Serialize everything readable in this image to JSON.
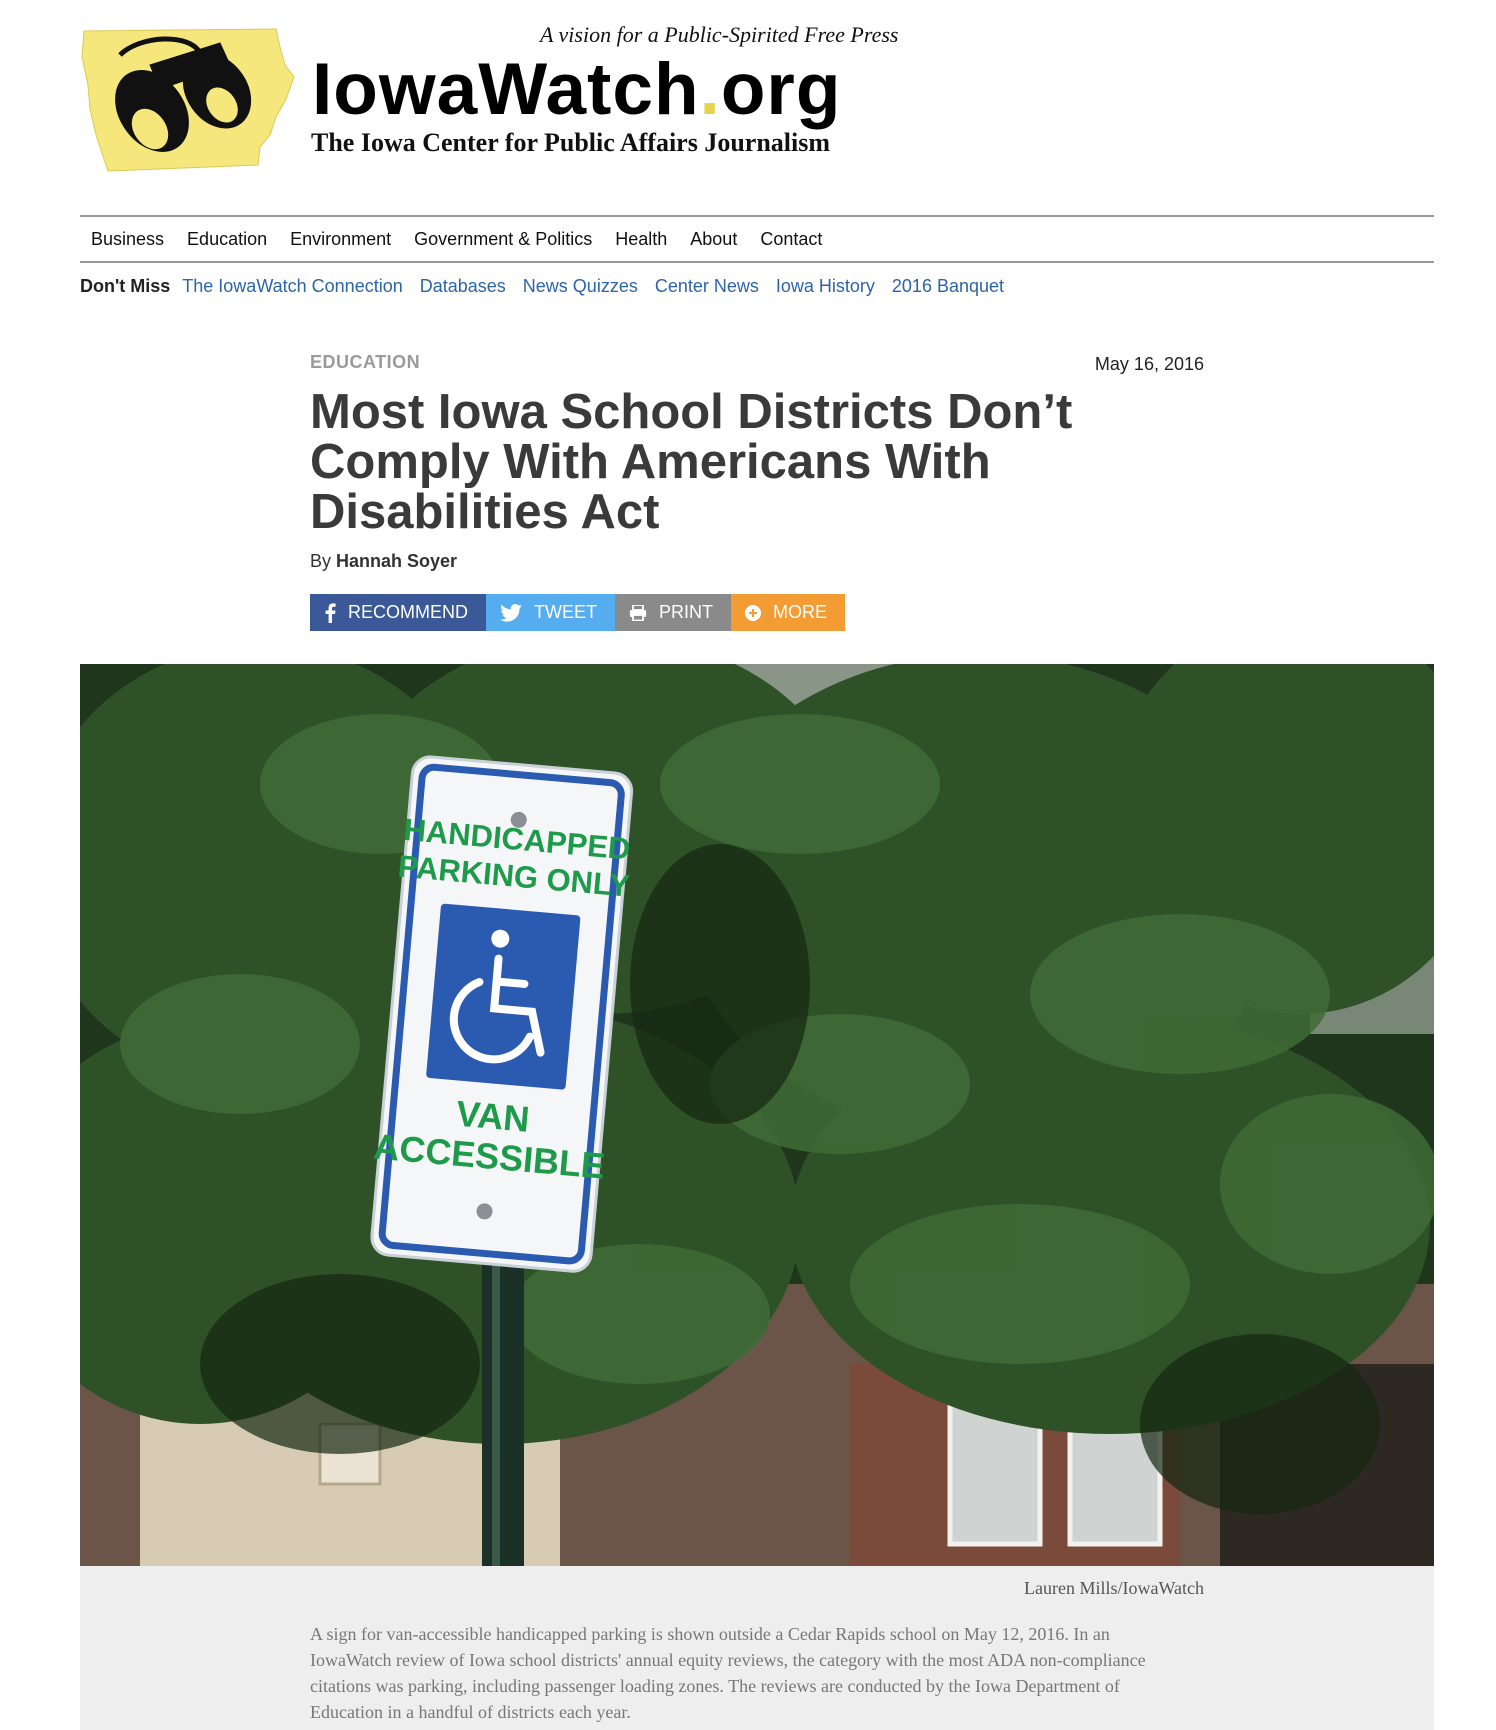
{
  "site": {
    "tagline": "A vision for a Public-Spirited Free Press",
    "logo_main": "IowaWatch",
    "logo_dot": ".",
    "logo_tld": "org",
    "logo_sub": "The Iowa Center for Public Affairs Journalism"
  },
  "nav": {
    "items": [
      "Business",
      "Education",
      "Environment",
      "Government & Politics",
      "Health",
      "About",
      "Contact"
    ]
  },
  "dont_miss": {
    "label": "Don't Miss",
    "links": [
      "The IowaWatch Connection",
      "Databases",
      "News Quizzes",
      "Center News",
      "Iowa History",
      "2016 Banquet"
    ]
  },
  "article": {
    "category": "EDUCATION",
    "date": "May 16, 2016",
    "headline": "Most Iowa School Districts Don’t Comply With Americans With Disabilities Act",
    "by": "By",
    "author": "Hannah Soyer",
    "share": {
      "recommend": "RECOMMEND",
      "tweet": "TWEET",
      "print": "PRINT",
      "more": "MORE"
    }
  },
  "photo": {
    "sign_line1": "HANDICAPPED",
    "sign_line2": "PARKING ONLY",
    "sign_line3": "VAN",
    "sign_line4": "ACCESSIBLE",
    "credit": "Lauren Mills/IowaWatch",
    "caption": "A sign for van-accessible handicapped parking is shown outside a Cedar Rapids school on May 12, 2016. In an IowaWatch review of Iowa school districts' annual equity reviews, the category with the most ADA non-compliance citations was parking, including passenger loading zones. The reviews are conducted by the Iowa Department of Education in a handful of districts each year."
  },
  "colors": {
    "facebook": "#3b5998",
    "twitter": "#55acee",
    "print": "#8a8a8a",
    "more": "#f29c33",
    "link": "#2c64a8",
    "logo_yellow": "#f5e77c"
  }
}
